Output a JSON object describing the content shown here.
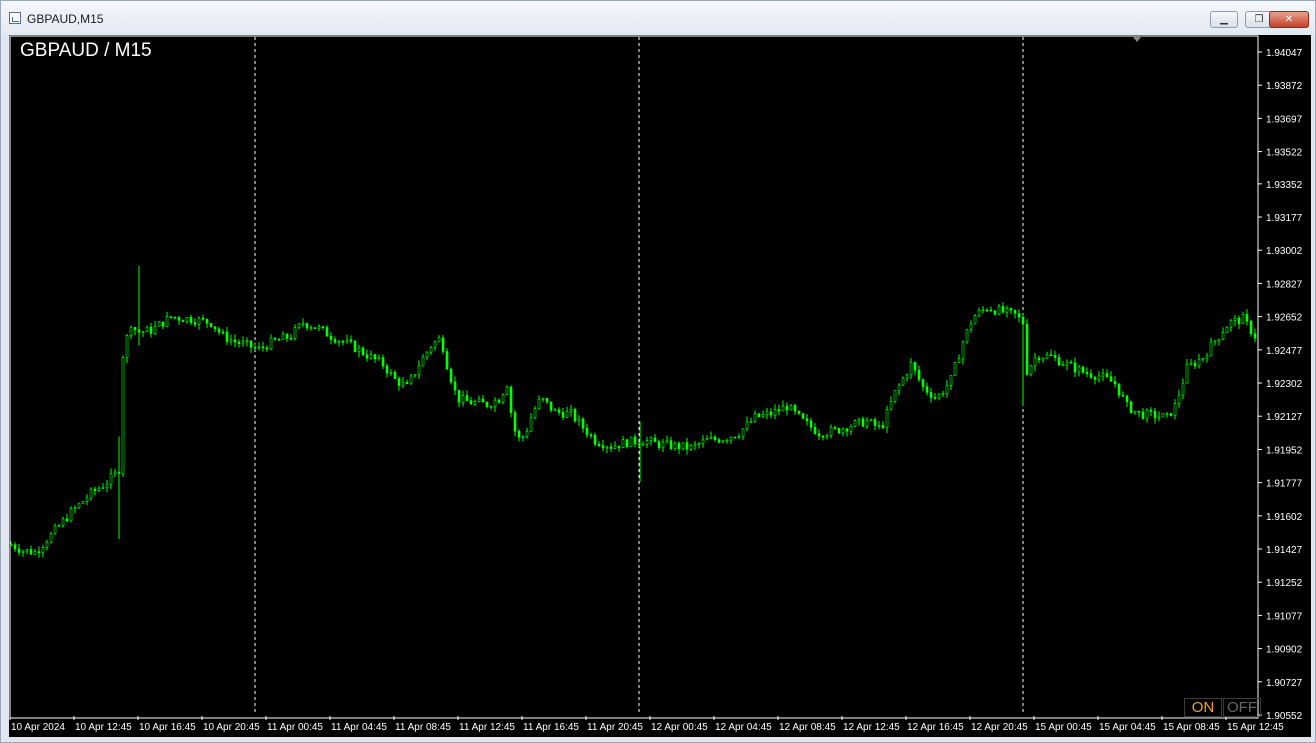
{
  "window": {
    "title": "GBPAUD,M15",
    "minimize_label": "▁",
    "restore_label": "❐",
    "close_label": "✕"
  },
  "chart": {
    "symbol_title": "GBPAUD / M15",
    "on_label": "ON",
    "off_label": "OFF",
    "colors": {
      "background": "#000000",
      "candle": "#00ff00",
      "axis_text": "#ffffff",
      "separator": "#ffffff"
    }
  },
  "chart_data": {
    "type": "candlestick",
    "ylim": [
      1.90552,
      1.94047
    ],
    "price_ticks": [
      "1.94047",
      "1.93872",
      "1.93697",
      "1.93522",
      "1.93352",
      "1.93177",
      "1.93002",
      "1.92827",
      "1.92652",
      "1.92477",
      "1.92302",
      "1.92127",
      "1.91952",
      "1.91777",
      "1.91602",
      "1.91427",
      "1.91252",
      "1.91077",
      "1.90902",
      "1.90727",
      "1.90552"
    ],
    "time_labels": [
      "10 Apr 2024",
      "10 Apr 12:45",
      "10 Apr 16:45",
      "10 Apr 20:45",
      "11 Apr 00:45",
      "11 Apr 04:45",
      "11 Apr 08:45",
      "11 Apr 12:45",
      "11 Apr 16:45",
      "11 Apr 20:45",
      "12 Apr 00:45",
      "12 Apr 04:45",
      "12 Apr 08:45",
      "12 Apr 12:45",
      "12 Apr 16:45",
      "12 Apr 20:45",
      "15 Apr 00:45",
      "15 Apr 04:45",
      "15 Apr 08:45",
      "15 Apr 12:45"
    ],
    "close_path": [
      [
        0,
        1.9145
      ],
      [
        12,
        1.9142
      ],
      [
        24,
        1.9141
      ],
      [
        40,
        1.915
      ],
      [
        60,
        1.9162
      ],
      [
        80,
        1.9172
      ],
      [
        96,
        1.9178
      ],
      [
        104,
        1.9182
      ],
      [
        108,
        1.9185
      ],
      [
        110,
        1.924
      ],
      [
        114,
        1.925
      ],
      [
        120,
        1.9262
      ],
      [
        126,
        1.9257
      ],
      [
        140,
        1.9258
      ],
      [
        160,
        1.9265
      ],
      [
        180,
        1.9264
      ],
      [
        200,
        1.9262
      ],
      [
        212,
        1.9255
      ],
      [
        224,
        1.9252
      ],
      [
        236,
        1.925
      ],
      [
        248,
        1.9248
      ],
      [
        262,
        1.9252
      ],
      [
        280,
        1.9255
      ],
      [
        292,
        1.9262
      ],
      [
        304,
        1.926
      ],
      [
        320,
        1.9255
      ],
      [
        340,
        1.925
      ],
      [
        356,
        1.9245
      ],
      [
        372,
        1.924
      ],
      [
        384,
        1.9232
      ],
      [
        396,
        1.9228
      ],
      [
        408,
        1.924
      ],
      [
        420,
        1.925
      ],
      [
        430,
        1.9254
      ],
      [
        436,
        1.924
      ],
      [
        446,
        1.9222
      ],
      [
        460,
        1.922
      ],
      [
        476,
        1.9219
      ],
      [
        488,
        1.9222
      ],
      [
        496,
        1.923
      ],
      [
        500,
        1.9215
      ],
      [
        506,
        1.92
      ],
      [
        514,
        1.9203
      ],
      [
        522,
        1.9215
      ],
      [
        530,
        1.9222
      ],
      [
        544,
        1.9215
      ],
      [
        560,
        1.9214
      ],
      [
        570,
        1.9208
      ],
      [
        584,
        1.92
      ],
      [
        600,
        1.9197
      ],
      [
        616,
        1.9199
      ],
      [
        632,
        1.92
      ],
      [
        648,
        1.9198
      ],
      [
        664,
        1.9197
      ],
      [
        680,
        1.9196
      ],
      [
        696,
        1.92
      ],
      [
        712,
        1.9201
      ],
      [
        728,
        1.9204
      ],
      [
        744,
        1.9212
      ],
      [
        760,
        1.9214
      ],
      [
        776,
        1.9218
      ],
      [
        792,
        1.921
      ],
      [
        808,
        1.9204
      ],
      [
        824,
        1.9205
      ],
      [
        840,
        1.9208
      ],
      [
        856,
        1.921
      ],
      [
        870,
        1.9206
      ],
      [
        884,
        1.9225
      ],
      [
        900,
        1.924
      ],
      [
        912,
        1.9228
      ],
      [
        926,
        1.9222
      ],
      [
        940,
        1.9232
      ],
      [
        952,
        1.9252
      ],
      [
        962,
        1.9265
      ],
      [
        976,
        1.927
      ],
      [
        990,
        1.9268
      ],
      [
        1004,
        1.9266
      ],
      [
        1012,
        1.9262
      ],
      [
        1014,
        1.9235
      ],
      [
        1026,
        1.9245
      ],
      [
        1040,
        1.9244
      ],
      [
        1056,
        1.924
      ],
      [
        1072,
        1.9236
      ],
      [
        1088,
        1.9234
      ],
      [
        1104,
        1.923
      ],
      [
        1116,
        1.9218
      ],
      [
        1128,
        1.9214
      ],
      [
        1144,
        1.9213
      ],
      [
        1156,
        1.9212
      ],
      [
        1164,
        1.9218
      ],
      [
        1176,
        1.9238
      ],
      [
        1192,
        1.9244
      ],
      [
        1206,
        1.9254
      ],
      [
        1218,
        1.9262
      ],
      [
        1232,
        1.9264
      ],
      [
        1244,
        1.9255
      ],
      [
        1249,
        1.9248
      ]
    ],
    "spikes": [
      {
        "x": 110,
        "low": 1.9148,
        "high": 1.9202
      },
      {
        "x": 130,
        "low": 1.925,
        "high": 1.9292
      },
      {
        "x": 631,
        "low": 1.9178,
        "high": 1.921
      },
      {
        "x": 1014,
        "low": 1.9218,
        "high": 1.9262
      }
    ]
  }
}
